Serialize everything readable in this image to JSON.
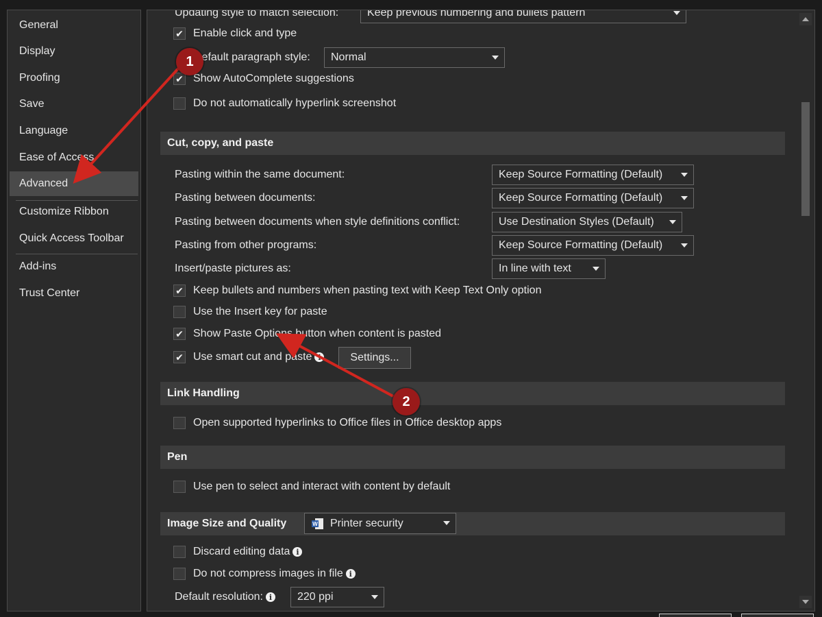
{
  "sidebar": {
    "items": [
      {
        "label": "General"
      },
      {
        "label": "Display"
      },
      {
        "label": "Proofing"
      },
      {
        "label": "Save"
      },
      {
        "label": "Language"
      },
      {
        "label": "Ease of Access"
      },
      {
        "label": "Advanced",
        "selected": true
      },
      {
        "label": "Customize Ribbon"
      },
      {
        "label": "Quick Access Toolbar"
      },
      {
        "label": "Add-ins"
      },
      {
        "label": "Trust Center"
      }
    ]
  },
  "editing": {
    "updating_style_label": "Updating style to match selection:",
    "updating_style_value": "Keep previous numbering and bullets pattern",
    "enable_click_type": {
      "label": "Enable click and type",
      "checked": true
    },
    "default_paragraph_label": "Default paragraph style:",
    "default_paragraph_value": "Normal",
    "show_autocomplete": {
      "label": "Show AutoComplete suggestions",
      "checked": true
    },
    "no_auto_hyperlink": {
      "label": "Do not automatically hyperlink screenshot",
      "checked": false
    }
  },
  "cut_copy_paste": {
    "heading": "Cut, copy, and paste",
    "rows": [
      {
        "label": "Pasting within the same document:",
        "value": "Keep Source Formatting (Default)"
      },
      {
        "label": "Pasting between documents:",
        "value": "Keep Source Formatting (Default)"
      },
      {
        "label": "Pasting between documents when style definitions conflict:",
        "value": "Use Destination Styles (Default)"
      },
      {
        "label": "Pasting from other programs:",
        "value": "Keep Source Formatting (Default)"
      },
      {
        "label": "Insert/paste pictures as:",
        "value": "In line with text"
      }
    ],
    "keep_bullets": {
      "label": "Keep bullets and numbers when pasting text with Keep Text Only option",
      "checked": true
    },
    "insert_key": {
      "label": "Use the Insert key for paste",
      "checked": false
    },
    "show_paste_options": {
      "label": "Show Paste Options button when content is pasted",
      "checked": true
    },
    "smart_cut": {
      "label": "Use smart cut and paste",
      "checked": true
    },
    "settings_button": "Settings..."
  },
  "link_handling": {
    "heading": "Link Handling",
    "open_supported": {
      "label": "Open supported hyperlinks to Office files in Office desktop apps",
      "checked": false
    }
  },
  "pen": {
    "heading": "Pen",
    "use_pen": {
      "label": "Use pen to select and interact with content by default",
      "checked": false
    }
  },
  "image_quality": {
    "heading": "Image Size and Quality",
    "document_value": "Printer security",
    "discard_editing": {
      "label": "Discard editing data",
      "checked": false
    },
    "no_compress": {
      "label": "Do not compress images in file",
      "checked": false
    },
    "default_resolution_label": "Default resolution:",
    "default_resolution_value": "220 ppi"
  },
  "annotations": {
    "marker_1": "1",
    "marker_2": "2",
    "color": "#c8221d"
  },
  "icons": {
    "check": "✔",
    "info": "i",
    "doc": "word-document-icon"
  }
}
